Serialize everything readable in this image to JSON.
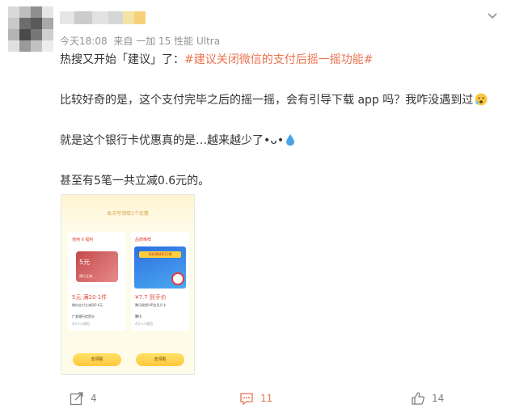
{
  "post": {
    "meta": {
      "time": "今天18:08",
      "source": "来自 一加 15 性能 Ultra"
    },
    "line1_prefix": "热搜又开始「建议」了：",
    "line1_hashtag": "#建议关闭微信的支付后摇一摇功能#",
    "line2": "比较好奇的是，这个支付完毕之后的摇一摇，会有引导下载 app 吗？我咋没遇到过",
    "line3": "就是这个银行卡优惠真的是…越来越少了•ᴗ•",
    "line4": "甚至有5笔一共立减0.6元的。",
    "icons": {
      "line2_emoji": "worried-emoji",
      "line3_emoji": "droplet-emoji",
      "caret": "chevron-down-icon"
    }
  },
  "screenshot": {
    "title": "本次可领取1个优惠",
    "left_card": {
      "tag": "使用 6 福利",
      "card_amount": "5元",
      "card_bank": "建行立减",
      "price": "5元 满20·1件",
      "desc": "微信支付立减同0.6元",
      "shop": "广发银行信用卡",
      "dots": "4万+人使用"
    },
    "right_card": {
      "tag": "品牌推荐",
      "band": "领券满就享12期",
      "price": "¥7.7 到手价",
      "desc": "腾讯视频VIP会员月卡",
      "shop": "腾讯",
      "dots": "4万+人使用"
    },
    "claim_left": "去领取",
    "claim_right": "去领取"
  },
  "actions": {
    "repost_count": "4",
    "comment_count": "11",
    "like_count": "14"
  },
  "colors": {
    "accent": "#eb7350",
    "text": "#333333",
    "muted": "#939393"
  }
}
